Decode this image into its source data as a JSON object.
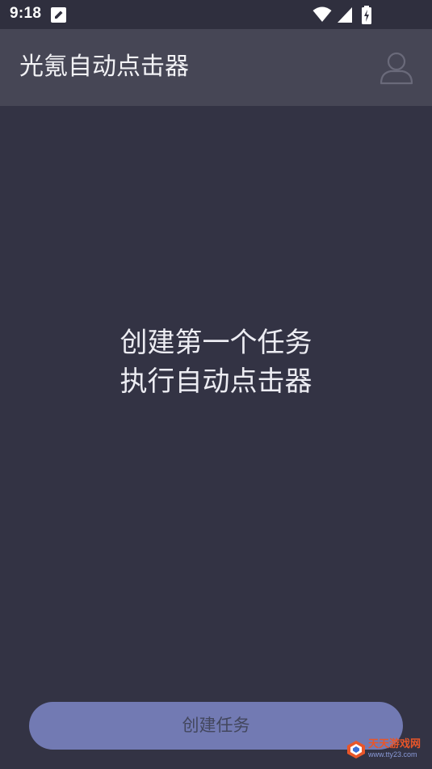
{
  "status_bar": {
    "time": "9:18",
    "icons": [
      "notification-edit-icon",
      "wifi-icon",
      "cellular-signal-icon",
      "battery-charging-icon"
    ]
  },
  "app_bar": {
    "title": "光氪自动点击器",
    "profile_icon": "user-icon"
  },
  "empty_state": {
    "line1": "创建第一个任务",
    "line2": "执行自动点击器"
  },
  "actions": {
    "create_task_label": "创建任务"
  },
  "watermark": {
    "title": "天天游戏网",
    "url": "www.tty23.com"
  },
  "colors": {
    "background": "#333344",
    "app_bar": "#464655",
    "button": "#727ab3",
    "watermark_accent": "#e8562a"
  }
}
